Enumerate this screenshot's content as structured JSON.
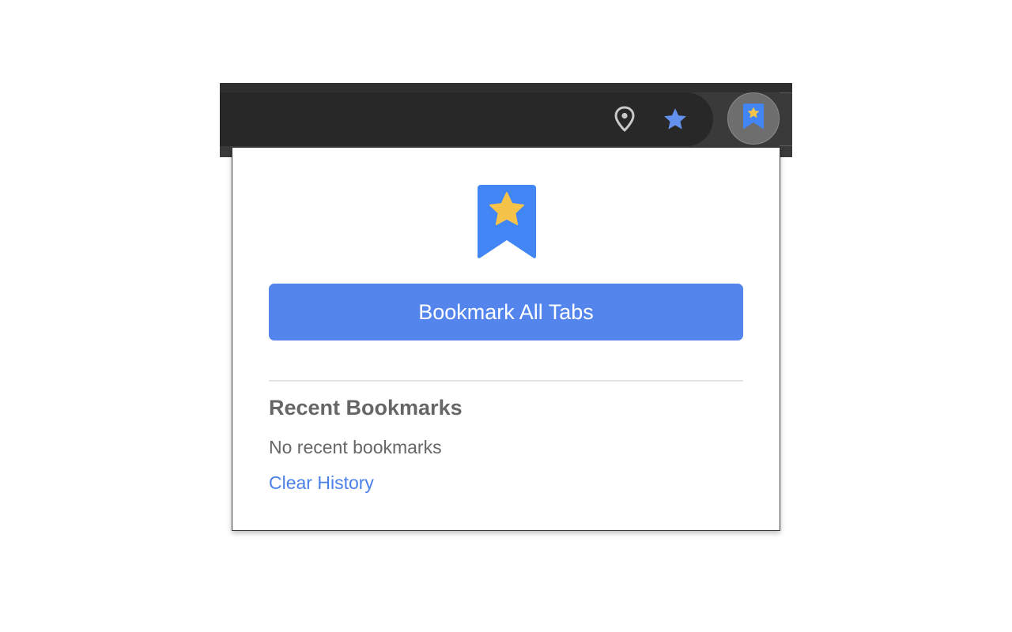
{
  "toolbar": {
    "icons": {
      "location": "location-pin-icon",
      "bookmark_star": "star-icon",
      "extension": "bookmark-ribbon-icon"
    }
  },
  "popup": {
    "hero_icon": "bookmark-ribbon-icon",
    "primary_button_label": "Bookmark All Tabs",
    "recent": {
      "title": "Recent Bookmarks",
      "empty_message": "No recent bookmarks",
      "clear_link": "Clear History"
    }
  },
  "colors": {
    "accent_blue": "#5385ed",
    "star_yellow": "#f5c34a",
    "link_blue": "#4a80e8",
    "text_gray": "#666666",
    "toolbar_dark": "#282828"
  }
}
